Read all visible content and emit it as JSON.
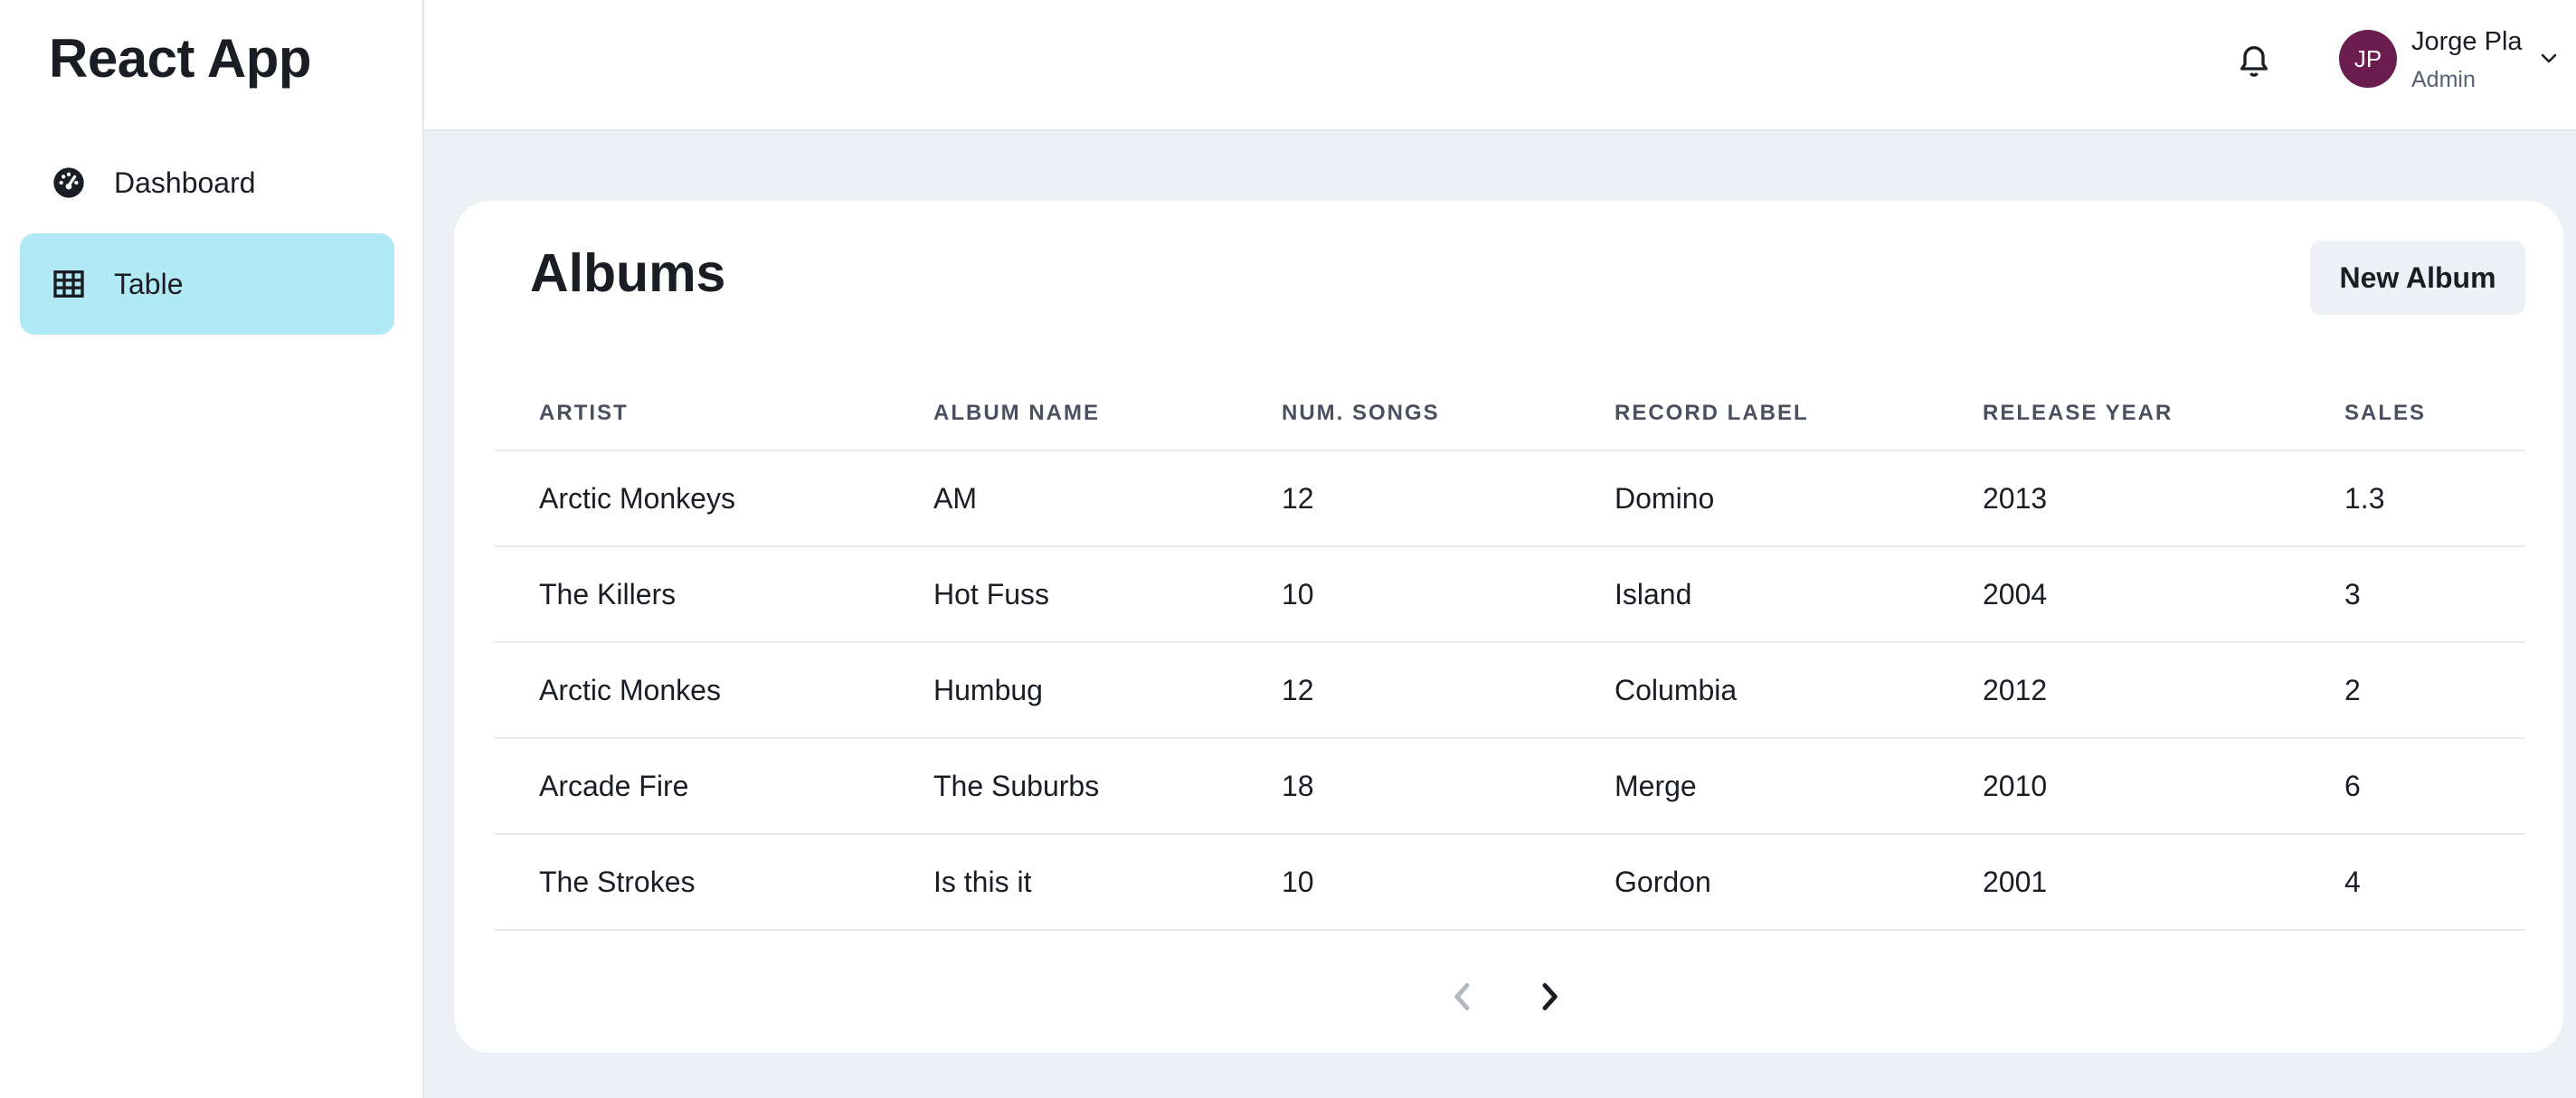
{
  "app": {
    "title": "React App"
  },
  "sidebar": {
    "items": [
      {
        "label": "Dashboard",
        "icon": "gauge-icon",
        "active": false
      },
      {
        "label": "Table",
        "icon": "table-icon",
        "active": true
      }
    ]
  },
  "header": {
    "user": {
      "initials": "JP",
      "name": "Jorge Pla",
      "role": "Admin"
    }
  },
  "main": {
    "title": "Albums",
    "new_button_label": "New Album",
    "table": {
      "headers": [
        "ARTIST",
        "ALBUM NAME",
        "NUM. SONGS",
        "RECORD LABEL",
        "RELEASE YEAR",
        "SALES"
      ],
      "rows": [
        [
          "Arctic Monkeys",
          "AM",
          "12",
          "Domino",
          "2013",
          "1.3"
        ],
        [
          "The Killers",
          "Hot Fuss",
          "10",
          "Island",
          "2004",
          "3"
        ],
        [
          "Arctic Monkes",
          "Humbug",
          "12",
          "Columbia",
          "2012",
          "2"
        ],
        [
          "Arcade Fire",
          "The Suburbs",
          "18",
          "Merge",
          "2010",
          "6"
        ],
        [
          "The Strokes",
          "Is this it",
          "10",
          "Gordon",
          "2001",
          "4"
        ]
      ]
    },
    "pagination": {
      "prev_enabled": false,
      "next_enabled": true
    }
  },
  "colors": {
    "accent": "#b1e9f4",
    "avatar": "#6b1d4f",
    "background": "#edf0f4"
  }
}
